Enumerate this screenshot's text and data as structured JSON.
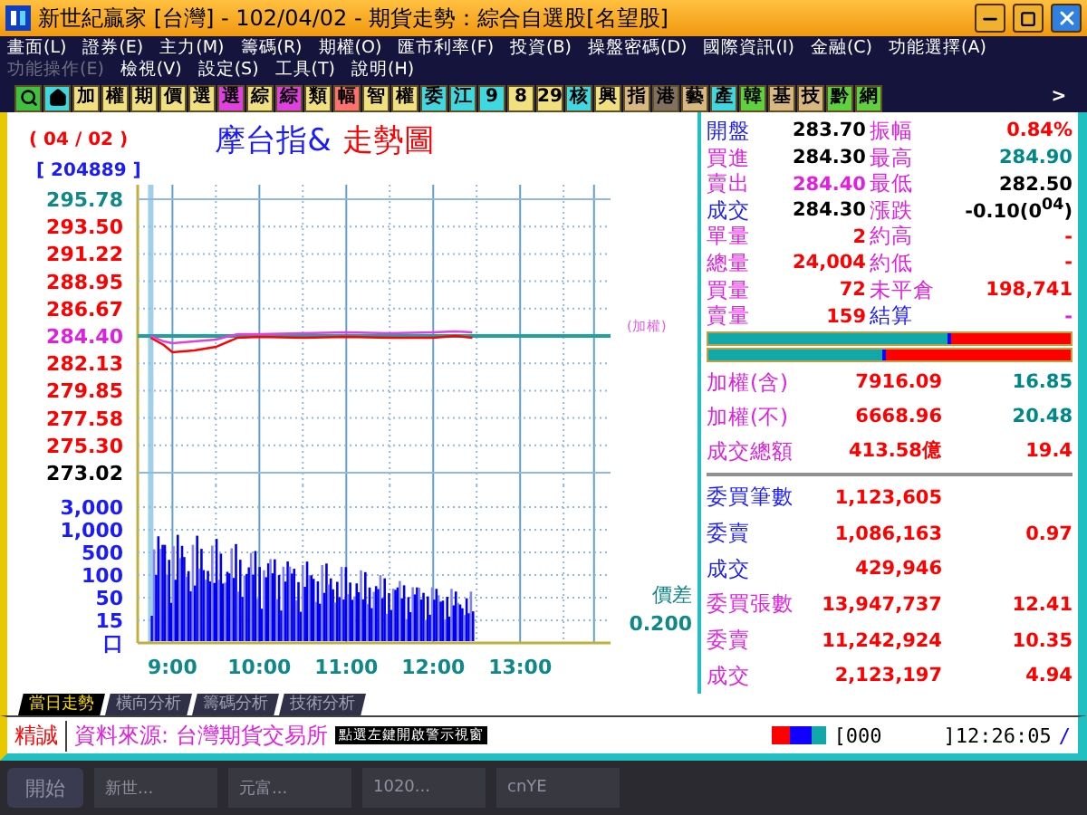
{
  "window": {
    "title": "新世紀贏家 [台灣]  - 102/04/02 - 期貨走勢：綜合自選股[名望股]"
  },
  "menu": [
    {
      "label": "畫面(L)",
      "disabled": false
    },
    {
      "label": "證券(E)",
      "disabled": false
    },
    {
      "label": "主力(M)",
      "disabled": false
    },
    {
      "label": "籌碼(R)",
      "disabled": false
    },
    {
      "label": "期權(O)",
      "disabled": false
    },
    {
      "label": "匯市利率(F)",
      "disabled": false
    },
    {
      "label": "投資(B)",
      "disabled": false
    },
    {
      "label": "操盤密碼(D)",
      "disabled": false
    },
    {
      "label": "國際資訊(I)",
      "disabled": false
    },
    {
      "label": "金融(C)",
      "disabled": false
    },
    {
      "label": "功能選擇(A)",
      "disabled": false
    },
    {
      "label": "功能操作(E)",
      "disabled": true
    },
    {
      "label": "檢視(V)",
      "disabled": false
    },
    {
      "label": "設定(S)",
      "disabled": false
    },
    {
      "label": "工具(T)",
      "disabled": false
    },
    {
      "label": "說明(H)",
      "disabled": false
    }
  ],
  "toolbar": [
    {
      "kind": "search",
      "color": "#40c040"
    },
    {
      "kind": "home",
      "color": "#40d8e0"
    },
    {
      "kind": "text",
      "label": "加",
      "color": "#f0e080"
    },
    {
      "kind": "text",
      "label": "權",
      "color": "#f0e080"
    },
    {
      "kind": "text",
      "label": "期",
      "color": "#f0e080"
    },
    {
      "kind": "text",
      "label": "價",
      "color": "#f0e080"
    },
    {
      "kind": "text",
      "label": "選",
      "color": "#f0e080"
    },
    {
      "kind": "text",
      "label": "選",
      "color": "#e040e0"
    },
    {
      "kind": "text",
      "label": "綜",
      "color": "#f0e080"
    },
    {
      "kind": "text",
      "label": "綜",
      "color": "#e040e0"
    },
    {
      "kind": "text",
      "label": "類",
      "color": "#f0e080"
    },
    {
      "kind": "text",
      "label": "幅",
      "color": "#ff7070"
    },
    {
      "kind": "text",
      "label": "智",
      "color": "#f0e080"
    },
    {
      "kind": "text",
      "label": "權",
      "color": "#f0e080"
    },
    {
      "kind": "text",
      "label": "委",
      "color": "#40d8e0"
    },
    {
      "kind": "text",
      "label": "江",
      "color": "#40d8e0"
    },
    {
      "kind": "text",
      "label": "9",
      "color": "#40d8e0"
    },
    {
      "kind": "text",
      "label": "8",
      "color": "#f0e080"
    },
    {
      "kind": "text",
      "label": "29",
      "color": "#f0e080"
    },
    {
      "kind": "text",
      "label": "核",
      "color": "#40d8e0"
    },
    {
      "kind": "text",
      "label": "興",
      "color": "#f0e080"
    },
    {
      "kind": "text",
      "label": "指",
      "color": "#d8b880"
    },
    {
      "kind": "text",
      "label": "港",
      "color": "#807060"
    },
    {
      "kind": "text",
      "label": "藝",
      "color": "#d8b880"
    },
    {
      "kind": "text",
      "label": "產",
      "color": "#40d8e0"
    },
    {
      "kind": "text",
      "label": "韓",
      "color": "#60d040"
    },
    {
      "kind": "text",
      "label": "基",
      "color": "#d8b880"
    },
    {
      "kind": "text",
      "label": "技",
      "color": "#d8b880"
    },
    {
      "kind": "text",
      "label": "黔",
      "color": "#60d040"
    },
    {
      "kind": "text",
      "label": "網",
      "color": "#60d040"
    },
    {
      "kind": "more",
      "label": ">",
      "color": "#14143c"
    }
  ],
  "chart": {
    "date": "( 04 / 02 )",
    "code": "[ 204889 ]",
    "name": "摩台指&",
    "suffix": "走勢圖",
    "price_scale": [
      {
        "text": "295.78",
        "kind": "limit_up"
      },
      {
        "text": "293.50",
        "kind": "normal"
      },
      {
        "text": "291.22",
        "kind": "normal"
      },
      {
        "text": "288.95",
        "kind": "normal"
      },
      {
        "text": "286.67",
        "kind": "normal"
      },
      {
        "text": "284.40",
        "kind": "reference"
      },
      {
        "text": "282.13",
        "kind": "normal"
      },
      {
        "text": "279.85",
        "kind": "normal"
      },
      {
        "text": "277.58",
        "kind": "normal"
      },
      {
        "text": "275.30",
        "kind": "normal"
      },
      {
        "text": "273.02",
        "kind": "limit_down"
      }
    ],
    "reference_label": "(加權)",
    "volume_ticks": [
      "3,000",
      "1,000",
      "500",
      "100",
      "50",
      "15",
      "口"
    ],
    "time_labels": [
      "9:00",
      "10:00",
      "11:00",
      "12:00",
      "13:00"
    ],
    "spread_label": "價差",
    "spread_value": "0.200"
  },
  "quote_rows": [
    {
      "cells": [
        {
          "text": "開盤",
          "color": "#1a1aff"
        },
        {
          "text": "283.70",
          "color": "#000000"
        },
        {
          "text": "振幅",
          "color": "#e020e0"
        },
        {
          "text": "0.84%",
          "color": "#ff0000"
        }
      ]
    },
    {
      "cells": [
        {
          "text": "買進",
          "color": "#e020e0"
        },
        {
          "text": "284.30",
          "color": "#000000"
        },
        {
          "text": "最高",
          "color": "#e020e0"
        },
        {
          "text": "284.90",
          "color": "#008888"
        }
      ]
    },
    {
      "cells": [
        {
          "text": "賣出",
          "color": "#e020e0"
        },
        {
          "text": "284.40",
          "color": "#e020e0"
        },
        {
          "text": "最低",
          "color": "#e020e0"
        },
        {
          "text": "282.50",
          "color": "#000000"
        }
      ]
    },
    {
      "cells": [
        {
          "text": "成交",
          "color": "#1a1aff"
        },
        {
          "text": "284.30",
          "color": "#000000"
        },
        {
          "text": "漲跌",
          "color": "#e020e0"
        },
        {
          "text": "-0.10(0$^{04}$)",
          "color": "#000000"
        }
      ]
    },
    {
      "cells": [
        {
          "text": "單量",
          "color": "#e020e0"
        },
        {
          "text": "2",
          "color": "#ff0000"
        },
        {
          "text": "約高",
          "color": "#e020e0"
        },
        {
          "text": "-",
          "color": "#ff0000"
        }
      ]
    },
    {
      "cells": [
        {
          "text": "總量",
          "color": "#e020e0"
        },
        {
          "text": "24,004",
          "color": "#ff0000"
        },
        {
          "text": "約低",
          "color": "#e020e0"
        },
        {
          "text": "-",
          "color": "#ff0000"
        }
      ]
    },
    {
      "cells": [
        {
          "text": "買量",
          "color": "#e020e0"
        },
        {
          "text": "72",
          "color": "#ff0000"
        },
        {
          "text": "未平倉",
          "color": "#e020e0"
        },
        {
          "text": "198,741",
          "color": "#ff0000"
        }
      ]
    },
    {
      "cells": [
        {
          "text": "賣量",
          "color": "#e020e0"
        },
        {
          "text": "159",
          "color": "#ff0000"
        },
        {
          "text": "結算",
          "color": "#1a1aff"
        },
        {
          "text": "-",
          "color": "#e020e0"
        }
      ]
    }
  ],
  "ratio_bars": [
    {
      "level": 0.67
    },
    {
      "level": 0.49
    }
  ],
  "index_rows": [
    {
      "cells": [
        {
          "text": "加權(含)",
          "color": "#e020e0"
        },
        {
          "text": "7916.09",
          "color": "#ff0000"
        },
        {
          "text": "16.85",
          "color": "#008888"
        }
      ]
    },
    {
      "cells": [
        {
          "text": "加權(不)",
          "color": "#e020e0"
        },
        {
          "text": "6668.96",
          "color": "#ff0000"
        },
        {
          "text": "20.48",
          "color": "#008888"
        }
      ]
    },
    {
      "cells": [
        {
          "text": "成交總額",
          "color": "#e020e0"
        },
        {
          "text": "413.58億",
          "color": "#ff0000"
        },
        {
          "text": "19.4",
          "color": "#ff0000"
        }
      ]
    }
  ],
  "order_rows": [
    {
      "cells": [
        {
          "text": "委買筆數",
          "color": "#1a1aff"
        },
        {
          "text": "1,123,605",
          "color": "#ff0000"
        }
      ]
    },
    {
      "cells": [
        {
          "text": "委賣",
          "color": "#1a1aff"
        },
        {
          "text": "1,086,163",
          "color": "#ff0000"
        },
        {
          "text": "0.97",
          "color": "#ff0000"
        }
      ]
    },
    {
      "cells": [
        {
          "text": "成交",
          "color": "#1a1aff"
        },
        {
          "text": "429,946",
          "color": "#ff0000"
        }
      ]
    },
    {
      "cells": [
        {
          "text": "委買張數",
          "color": "#e020e0"
        },
        {
          "text": "13,947,737",
          "color": "#ff0000"
        },
        {
          "text": "12.41",
          "color": "#ff0000"
        }
      ]
    },
    {
      "cells": [
        {
          "text": "委賣",
          "color": "#e020e0"
        },
        {
          "text": "11,242,924",
          "color": "#ff0000"
        },
        {
          "text": "10.35",
          "color": "#ff0000"
        }
      ]
    },
    {
      "cells": [
        {
          "text": "成交",
          "color": "#e020e0"
        },
        {
          "text": "2,123,197",
          "color": "#ff0000"
        },
        {
          "text": "4.94",
          "color": "#ff0000"
        }
      ]
    }
  ],
  "tabs": [
    {
      "label": "當日走勢",
      "selected": true
    },
    {
      "label": "橫向分析",
      "selected": false
    },
    {
      "label": "籌碼分析",
      "selected": false
    },
    {
      "label": "技術分析",
      "selected": false
    }
  ],
  "status_bar": {
    "broker": "精誠",
    "source": "資料來源: 台灣期貨交易所",
    "tooltip": "點選左鍵開啟警示視窗",
    "counter": "[000",
    "time": "]12:26:05",
    "marker": "/"
  },
  "taskbar": {
    "start": "開始",
    "items": [
      "新世...",
      "元富...",
      "1020...",
      "cnYE"
    ]
  }
}
